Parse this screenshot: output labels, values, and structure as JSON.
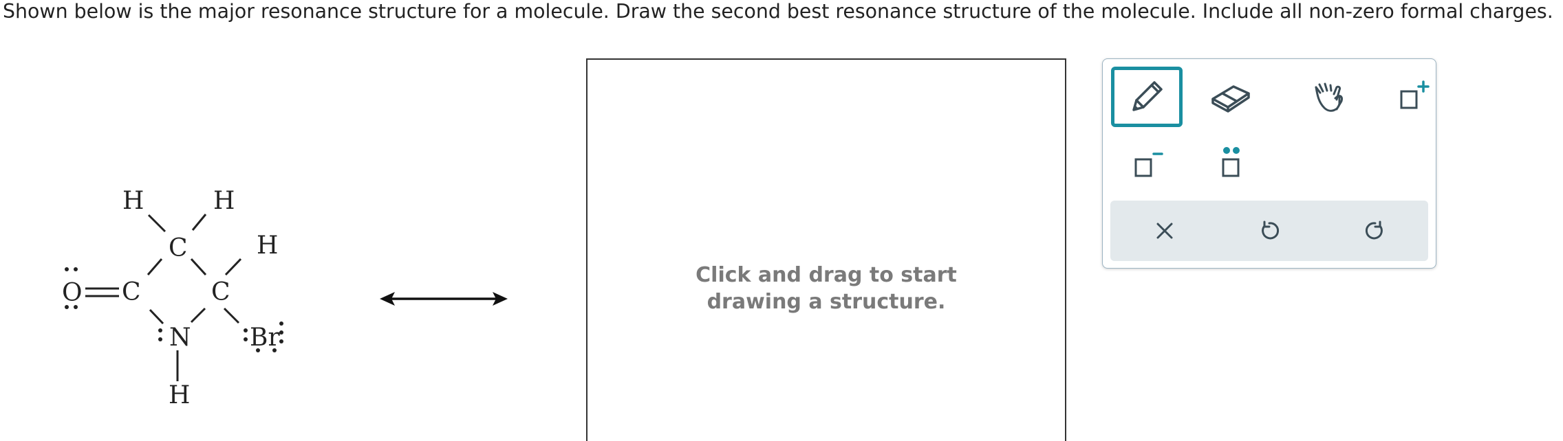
{
  "question": {
    "text": "Shown below is the major resonance structure for a molecule. Draw the second best resonance structure of the molecule. Include all non-zero formal charges."
  },
  "molecule": {
    "atoms": {
      "o": "O",
      "c1": "C",
      "c_top": "C",
      "c_right": "C",
      "n": "N",
      "br": "Br",
      "h_top_left": "H",
      "h_top_right": "H",
      "h_right": "H",
      "h_n": "H"
    }
  },
  "canvas": {
    "hint": "Click and drag to start drawing a structure."
  },
  "toolbox": {
    "tools": [
      {
        "name": "pencil-icon",
        "selected": true
      },
      {
        "name": "eraser-icon",
        "selected": false
      },
      {
        "name": "hand-icon",
        "selected": false
      },
      {
        "name": "positive-charge-icon",
        "selected": false
      },
      {
        "name": "negative-charge-icon",
        "selected": false
      },
      {
        "name": "lone-pair-icon",
        "selected": false
      }
    ],
    "actions": [
      "clear-icon",
      "undo-icon",
      "redo-icon"
    ],
    "colors": {
      "accent": "#1a8fa1",
      "icon": "#3b4d57",
      "action_bar": "#e3e9ec"
    }
  }
}
